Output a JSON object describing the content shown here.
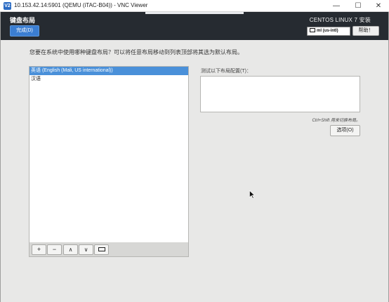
{
  "window": {
    "icon_text": "V2",
    "title": "10.153.42.14:5901 (QEMU (iTAC-B04)) - VNC Viewer",
    "minimize": "—",
    "maximize": "☐",
    "close": "✕"
  },
  "header": {
    "page_title": "键盘布局",
    "done_button": "完成(D)",
    "product_name": "CENTOS LINUX 7 安装",
    "keyboard_indicator": "ml (us-intl)",
    "help_button": "帮助！"
  },
  "main": {
    "instruction": "您要在系统中使用哪种键盘布局？可以将任意布局移动到列表顶部将其选为默认布局。",
    "layouts": [
      {
        "label": "英语 (English (Mali, US international))",
        "selected": true
      },
      {
        "label": "汉语",
        "selected": false
      }
    ],
    "toolbar": {
      "add": "+",
      "remove": "−",
      "up": "∧",
      "down": "∨"
    },
    "test_label": "测试以下布局配置(T)：",
    "test_value": "",
    "switch_hint": "Ctrl+Shift 用来切换布局。",
    "options_button": "选项(O)"
  },
  "colors": {
    "header_bg": "#262b31",
    "accent": "#3b7ed2",
    "selection": "#4a90d9",
    "content_bg": "#e8e8e7"
  },
  "icons": {
    "app": "vnc-viewer-icon",
    "keyboard": "keyboard-icon",
    "cursor": "mouse-pointer-icon"
  }
}
